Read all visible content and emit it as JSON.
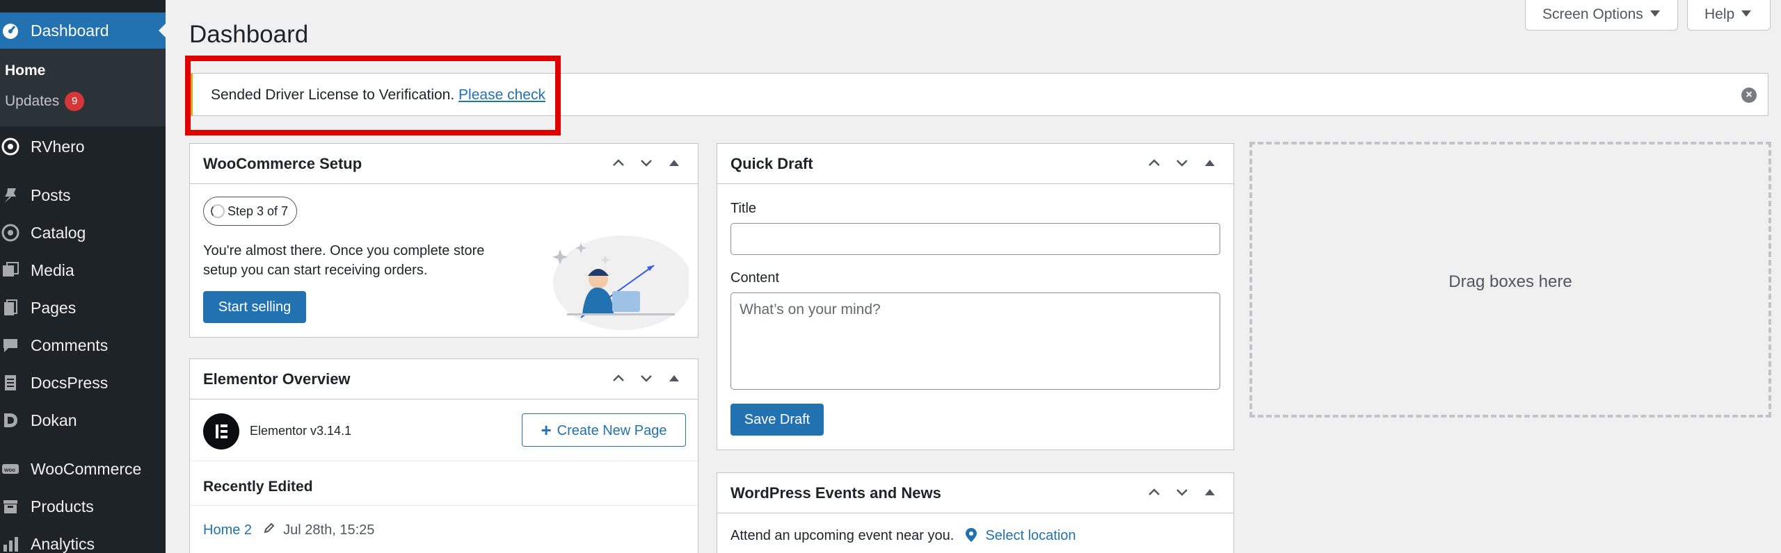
{
  "sidebar": {
    "active": "Dashboard",
    "submenu": [
      {
        "label": "Home"
      },
      {
        "label": "Updates",
        "badge": "9"
      }
    ],
    "items": [
      {
        "label": "RVhero",
        "icon": "rvhero-icon"
      },
      {
        "label": "Posts",
        "icon": "pin-icon"
      },
      {
        "label": "Catalog",
        "icon": "catalog-icon"
      },
      {
        "label": "Media",
        "icon": "media-icon"
      },
      {
        "label": "Pages",
        "icon": "pages-icon"
      },
      {
        "label": "Comments",
        "icon": "comment-icon"
      },
      {
        "label": "DocsPress",
        "icon": "docs-icon"
      },
      {
        "label": "Dokan",
        "icon": "dokan-icon"
      },
      {
        "label": "WooCommerce",
        "icon": "woo-icon"
      },
      {
        "label": "Products",
        "icon": "box-icon"
      },
      {
        "label": "Analytics",
        "icon": "analytics-icon"
      }
    ]
  },
  "header": {
    "screen_options": "Screen Options",
    "help": "Help",
    "title": "Dashboard"
  },
  "notice": {
    "text": "Sended Driver License to Verification.",
    "link": "Please check"
  },
  "woo_setup": {
    "title": "WooCommerce Setup",
    "step": "Step 3 of 7",
    "desc_line1": "You're almost there. Once you complete store",
    "desc_line2": "setup you can start receiving orders.",
    "button": "Start selling"
  },
  "elementor": {
    "title": "Elementor Overview",
    "version": "Elementor v3.14.1",
    "create_button": "Create New Page",
    "recent_title": "Recently Edited",
    "recent_item": "Home 2",
    "recent_date": "Jul 28th, 15:25"
  },
  "quick_draft": {
    "title": "Quick Draft",
    "title_label": "Title",
    "title_value": "",
    "content_label": "Content",
    "content_placeholder": "What’s on your mind?",
    "button": "Save Draft"
  },
  "events": {
    "title": "WordPress Events and News",
    "attend": "Attend an upcoming event near you.",
    "select_location": "Select location"
  },
  "dropzone": {
    "text": "Drag boxes here"
  },
  "colors": {
    "sidebar_bg": "#1d2327",
    "accent": "#2271b1",
    "highlight": "#e00000",
    "notice_warning": "#dba617",
    "badge": "#d63638"
  }
}
